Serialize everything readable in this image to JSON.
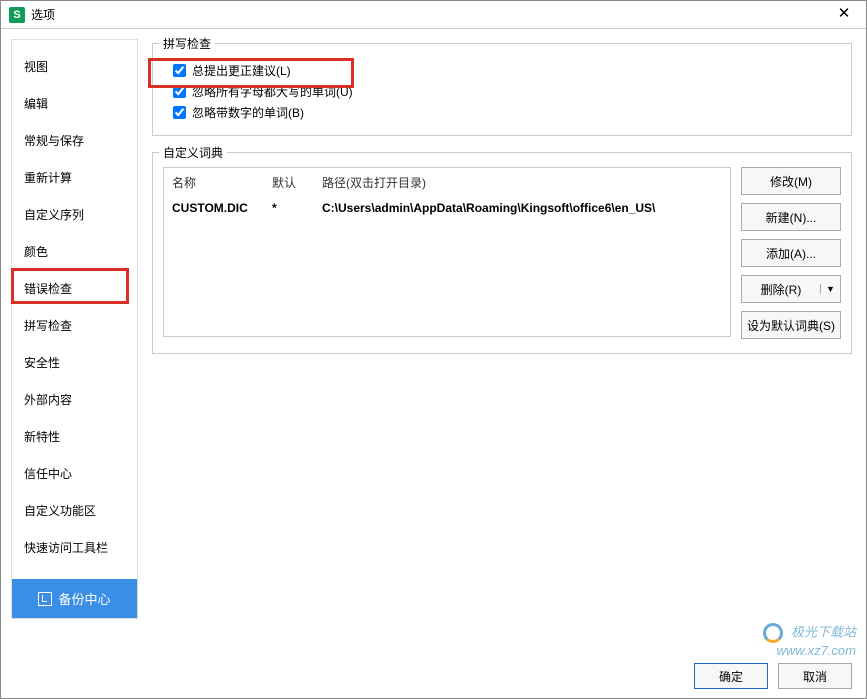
{
  "window": {
    "title": "选项"
  },
  "sidebar": {
    "items": [
      "视图",
      "编辑",
      "常规与保存",
      "重新计算",
      "自定义序列",
      "颜色",
      "错误检查",
      "拼写检查",
      "安全性",
      "外部内容",
      "新特性",
      "信任中心",
      "自定义功能区",
      "快速访问工具栏"
    ],
    "active": 7,
    "backup": "备份中心"
  },
  "spellcheck": {
    "legend": "拼写检查",
    "opt1": "总提出更正建议(L)",
    "opt2": "忽略所有字母都大写的单词(U)",
    "opt3": "忽略带数字的单词(B)"
  },
  "dict": {
    "legend": "自定义词典",
    "head_name": "名称",
    "head_default": "默认",
    "head_path": "路径(双击打开目录)",
    "row_name": "CUSTOM.DIC",
    "row_default": "*",
    "row_path": "C:\\Users\\admin\\AppData\\Roaming\\Kingsoft\\office6\\en_US\\",
    "btn_modify": "修改(M)",
    "btn_new": "新建(N)...",
    "btn_add": "添加(A)...",
    "btn_delete": "删除(R)",
    "btn_default": "设为默认词典(S)"
  },
  "footer": {
    "ok": "确定",
    "cancel": "取消"
  },
  "watermark": {
    "line1": "极光下载站",
    "line2": "www.xz7.com"
  }
}
